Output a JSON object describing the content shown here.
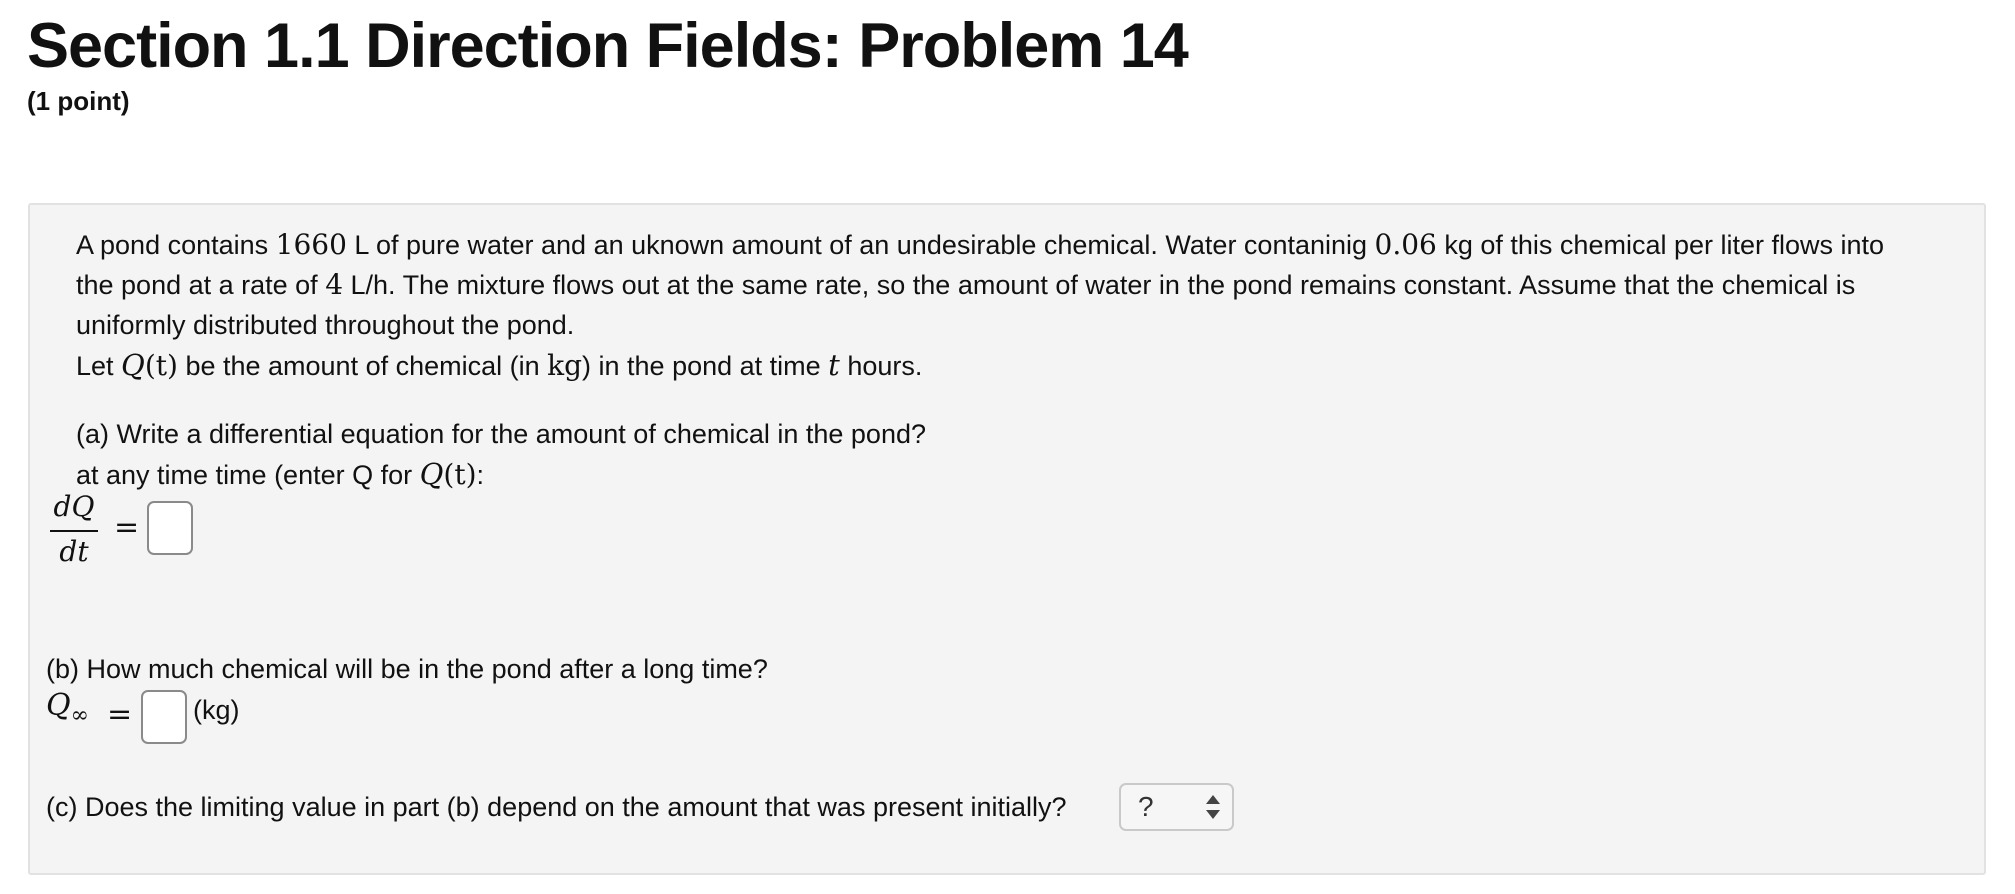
{
  "header": {
    "title": "Section 1.1 Direction Fields: Problem 14",
    "points": "(1 point)"
  },
  "problem": {
    "intro": {
      "l1_a": "A pond contains ",
      "l1_volume": "1660",
      "l1_b": " L of pure water and an uknown amount of an undesirable chemical. Water contaninig ",
      "l1_conc": "0.06",
      "l1_c": " kg of this chemical per liter flows into",
      "l2_a": "the pond at a rate of ",
      "l2_rate": "4",
      "l2_b": " L/h. The mixture flows out at the same rate, so the amount of water in the pond remains constant. Assume that the chemical is",
      "l3": "uniformly distributed throughout the pond.",
      "l4_a": "Let ",
      "l4_q": "Q",
      "l4_t": "(t)",
      "l4_b": " be the amount of chemical (in ",
      "l4_kg": "kg",
      "l4_c": ") in the pond at time ",
      "l4_time": "t",
      "l4_d": " hours."
    },
    "part_a": {
      "question": "(a) Write a differential equation for the amount of chemical in the pond?",
      "line2_a": "at any time time (enter Q for ",
      "line2_q": "Q",
      "line2_t": "(t)",
      "line2_b": ":",
      "numerator": "dQ",
      "denominator": "dt",
      "equals": "=",
      "answer_value": ""
    },
    "part_b": {
      "question": "(b) How much chemical will be in the pond after a long time?",
      "q_symbol": "Q",
      "q_subscript": "∞",
      "equals": "=",
      "answer_value": "",
      "unit": "(kg)"
    },
    "part_c": {
      "question": "(c) Does the limiting value in part (b) depend on the amount that was present initially?",
      "selected": "?"
    }
  }
}
